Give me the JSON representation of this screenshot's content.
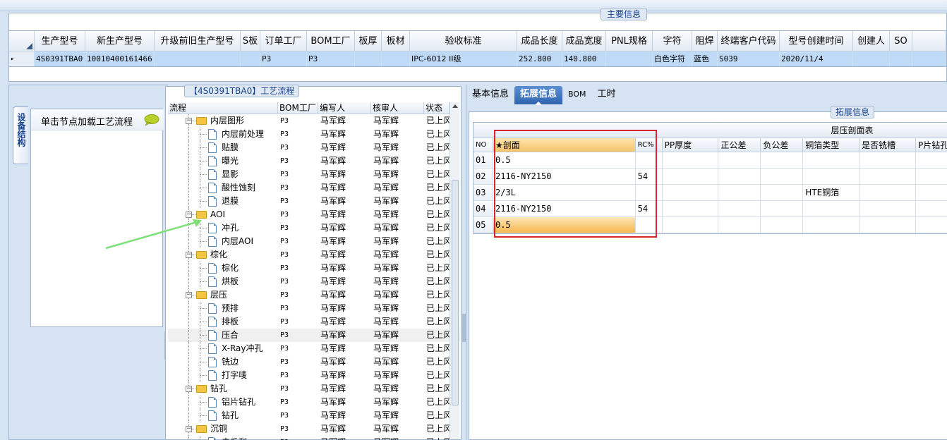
{
  "main_info": {
    "title": "主要信息",
    "columns": [
      "",
      "生产型号",
      "新生产型号",
      "升级前旧生产型号",
      "S板",
      "订单工厂",
      "BOM工厂",
      "板厚",
      "板材",
      "验收标准",
      "成品长度",
      "成品宽度",
      "PNL规格",
      "字符",
      "阻焊",
      "终端客户代码",
      "型号创建时间",
      "创建人",
      "SO"
    ],
    "row": [
      "▸",
      "4S0391TBA0",
      "10010400161466",
      "",
      "",
      "P3",
      "P3",
      "",
      "",
      "IPC-6012 II级",
      "252.800",
      "140.800",
      "",
      "白色字符",
      "蓝色",
      "S039",
      "2020/11/4",
      "",
      ""
    ]
  },
  "left_panel": {
    "vertical_tab": "设备结构",
    "node_hint": "单击节点加载工艺流程"
  },
  "flow_panel": {
    "title": "【4S0391TBA0】工艺流程",
    "columns": [
      "流程",
      "BOM工厂",
      "编写人",
      "核审人",
      "状态"
    ],
    "rows": [
      {
        "level": 1,
        "type": "folder",
        "name": "内层图形",
        "bom": "P3",
        "writer": "马军辉",
        "reviewer": "马军辉",
        "status": "已上风"
      },
      {
        "level": 2,
        "type": "doc",
        "name": "内层前处理",
        "bom": "P3",
        "writer": "马军辉",
        "reviewer": "马军辉",
        "status": "已上风"
      },
      {
        "level": 2,
        "type": "doc",
        "name": "贴膜",
        "bom": "P3",
        "writer": "马军辉",
        "reviewer": "马军辉",
        "status": "已上风"
      },
      {
        "level": 2,
        "type": "doc",
        "name": "曝光",
        "bom": "P3",
        "writer": "马军辉",
        "reviewer": "马军辉",
        "status": "已上风"
      },
      {
        "level": 2,
        "type": "doc",
        "name": "显影",
        "bom": "P3",
        "writer": "马军辉",
        "reviewer": "马军辉",
        "status": "已上风"
      },
      {
        "level": 2,
        "type": "doc",
        "name": "酸性蚀刻",
        "bom": "P3",
        "writer": "马军辉",
        "reviewer": "马军辉",
        "status": "已上风"
      },
      {
        "level": 2,
        "type": "doc",
        "name": "退膜",
        "bom": "P3",
        "writer": "马军辉",
        "reviewer": "马军辉",
        "status": "已上风"
      },
      {
        "level": 1,
        "type": "folder",
        "name": "AOI",
        "bom": "P3",
        "writer": "马军辉",
        "reviewer": "马军辉",
        "status": "已上风"
      },
      {
        "level": 2,
        "type": "doc",
        "name": "冲孔",
        "bom": "P3",
        "writer": "马军辉",
        "reviewer": "马军辉",
        "status": "已上风"
      },
      {
        "level": 2,
        "type": "doc",
        "name": "内层AOI",
        "bom": "P3",
        "writer": "马军辉",
        "reviewer": "马军辉",
        "status": "已上风"
      },
      {
        "level": 1,
        "type": "folder",
        "name": "棕化",
        "bom": "P3",
        "writer": "马军辉",
        "reviewer": "马军辉",
        "status": "已上风"
      },
      {
        "level": 2,
        "type": "doc",
        "name": "棕化",
        "bom": "P3",
        "writer": "马军辉",
        "reviewer": "马军辉",
        "status": "已上风"
      },
      {
        "level": 2,
        "type": "doc",
        "name": "烘板",
        "bom": "P3",
        "writer": "马军辉",
        "reviewer": "马军辉",
        "status": "已上风"
      },
      {
        "level": 1,
        "type": "folder",
        "name": "层压",
        "bom": "P3",
        "writer": "马军辉",
        "reviewer": "马军辉",
        "status": "已上风"
      },
      {
        "level": 2,
        "type": "doc",
        "name": "预排",
        "bom": "P3",
        "writer": "马军辉",
        "reviewer": "马军辉",
        "status": "已上风"
      },
      {
        "level": 2,
        "type": "doc",
        "name": "排板",
        "bom": "P3",
        "writer": "马军辉",
        "reviewer": "马军辉",
        "status": "已上风"
      },
      {
        "level": 2,
        "type": "doc",
        "name": "压合",
        "bom": "P3",
        "writer": "马军辉",
        "reviewer": "马军辉",
        "status": "已上风",
        "selected": true
      },
      {
        "level": 2,
        "type": "doc",
        "name": "X-Ray冲孔",
        "bom": "P3",
        "writer": "马军辉",
        "reviewer": "马军辉",
        "status": "已上风"
      },
      {
        "level": 2,
        "type": "doc",
        "name": "铣边",
        "bom": "P3",
        "writer": "马军辉",
        "reviewer": "马军辉",
        "status": "已上风"
      },
      {
        "level": 2,
        "type": "doc",
        "name": "打字唛",
        "bom": "P3",
        "writer": "马军辉",
        "reviewer": "马军辉",
        "status": "已上风"
      },
      {
        "level": 1,
        "type": "folder",
        "name": "钻孔",
        "bom": "P3",
        "writer": "马军辉",
        "reviewer": "马军辉",
        "status": "已上风"
      },
      {
        "level": 2,
        "type": "doc",
        "name": "铝片钻孔",
        "bom": "P3",
        "writer": "马军辉",
        "reviewer": "马军辉",
        "status": "已上风"
      },
      {
        "level": 2,
        "type": "doc",
        "name": "钻孔",
        "bom": "P3",
        "writer": "马军辉",
        "reviewer": "马军辉",
        "status": "已上风"
      },
      {
        "level": 1,
        "type": "folder",
        "name": "沉铜",
        "bom": "P3",
        "writer": "马军辉",
        "reviewer": "马军辉",
        "status": "已上风"
      },
      {
        "level": 2,
        "type": "doc",
        "name": "去毛刺",
        "bom": "P3",
        "writer": "马军辉",
        "reviewer": "马军辉",
        "status": "已上风"
      }
    ]
  },
  "right_panel": {
    "tabs": [
      "基本信息",
      "拓展信息",
      "BOM",
      "工时"
    ],
    "active_tab": 1,
    "group_title": "拓展信息",
    "table_title": "层压剖面表",
    "columns": [
      "NO",
      "★剖面",
      "RC%",
      "PP厚度",
      "正公差",
      "负公差",
      "铜箔类型",
      "是否铣槽",
      "P片钻孔"
    ],
    "rows": [
      [
        "01",
        "0.5",
        "",
        "",
        "",
        "",
        "",
        "",
        ""
      ],
      [
        "02",
        "2116-NY2150",
        "54",
        "",
        "",
        "",
        "",
        "",
        ""
      ],
      [
        "03",
        "2/3L",
        "",
        "",
        "",
        "",
        "HTE铜箔",
        "",
        ""
      ],
      [
        "04",
        "2116-NY2150",
        "54",
        "",
        "",
        "",
        "",
        "",
        ""
      ],
      [
        "05",
        "0.5",
        "",
        "",
        "",
        "",
        "",
        "",
        ""
      ]
    ]
  },
  "colors": {
    "accent": "#2f65b0",
    "highlight": "#d6262b",
    "arrow": "#7fe07a",
    "row_selected": "#bfdaf7"
  }
}
